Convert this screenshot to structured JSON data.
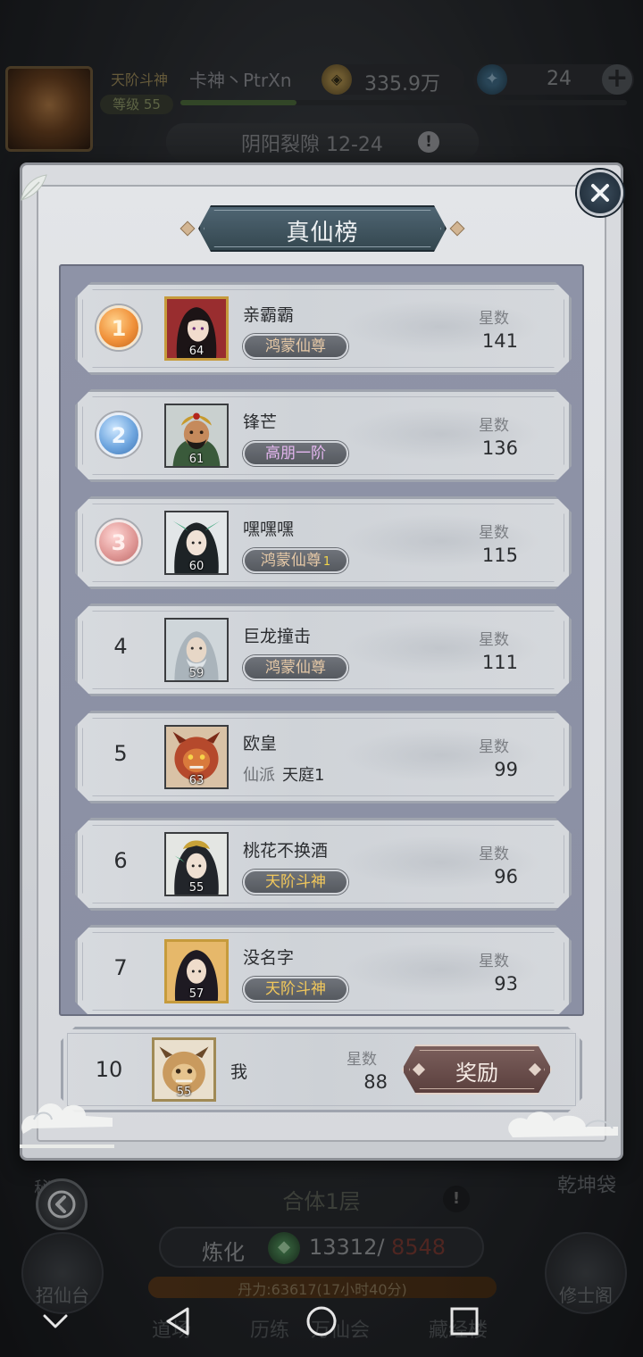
{
  "hud": {
    "rank_title": "天阶斗神",
    "player_name": "卡神丶PtrXn",
    "level_label": "等级 55",
    "coins": "335.9万",
    "gems": "24",
    "add_symbol": "+",
    "stage": "阴阳裂隙 12-24",
    "alert_symbol": "!"
  },
  "bottom": {
    "floor": "合体1层",
    "refine_label": "炼化",
    "refine_current": "13312/",
    "refine_max": "8548",
    "dan_text": "丹力:63617(17小时40分)",
    "left_top_label": "秘境",
    "left_btn_label": "招仙台",
    "right_top_label": "乾坤袋",
    "right_btn_label": "修士阁",
    "tabs": [
      "道场",
      "历练",
      "万仙会",
      "藏经楼"
    ]
  },
  "modal": {
    "title": "真仙榜",
    "stars_label": "星数",
    "ranking": [
      {
        "rank": "1",
        "name": "亲霸霸",
        "level": "64",
        "tag": "鸿蒙仙尊",
        "tag_sup": "",
        "stars": "141"
      },
      {
        "rank": "2",
        "name": "锋芒",
        "level": "61",
        "tag": "高朋一阶",
        "tag_sup": "",
        "stars": "136"
      },
      {
        "rank": "3",
        "name": "嘿嘿嘿",
        "level": "60",
        "tag": "鸿蒙仙尊",
        "tag_sup": "1",
        "stars": "115"
      },
      {
        "rank": "4",
        "name": "巨龙撞击",
        "level": "59",
        "tag": "鸿蒙仙尊",
        "tag_sup": "",
        "stars": "111"
      },
      {
        "rank": "5",
        "name": "欧皇",
        "level": "63",
        "sect_label": "仙派",
        "sect_value": "天庭1",
        "stars": "99"
      },
      {
        "rank": "6",
        "name": "桃花不换酒",
        "level": "55",
        "tag": "天阶斗神",
        "tag_sup": "",
        "stars": "96"
      },
      {
        "rank": "7",
        "name": "没名字",
        "level": "57",
        "tag": "天阶斗神",
        "tag_sup": "",
        "stars": "93"
      }
    ],
    "me": {
      "rank": "10",
      "name": "我",
      "level": "55",
      "stars": "88"
    },
    "reward_label": "奖励"
  }
}
